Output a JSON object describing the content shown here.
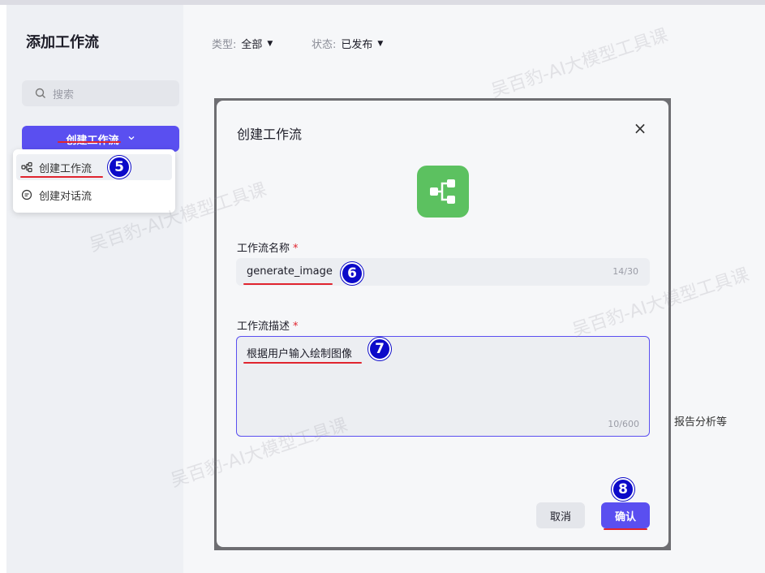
{
  "sidebar": {
    "title": "添加工作流",
    "search_placeholder": "搜索",
    "create_button": "创建工作流",
    "dropdown": [
      {
        "label": "创建工作流"
      },
      {
        "label": "创建对话流"
      }
    ]
  },
  "filters": {
    "type_label": "类型:",
    "type_value": "全部",
    "status_label": "状态:",
    "status_value": "已发布"
  },
  "background_text": "报告分析等",
  "modal": {
    "title": "创建工作流",
    "close": "×",
    "name_label": "工作流名称",
    "name_value": "generate_image",
    "name_count": "14/30",
    "desc_label": "工作流描述",
    "desc_value": "根据用户输入绘制图像",
    "desc_count": "10/600",
    "cancel": "取消",
    "confirm": "确认",
    "required_mark": "*"
  },
  "badges": [
    "5",
    "6",
    "7",
    "8"
  ],
  "watermark": "吴百豹-AI大模型工具课",
  "colors": {
    "accent": "#5a4ff0",
    "badge": "#0c0ac9",
    "underline": "#e0242e",
    "workflow_icon": "#5cc160"
  }
}
